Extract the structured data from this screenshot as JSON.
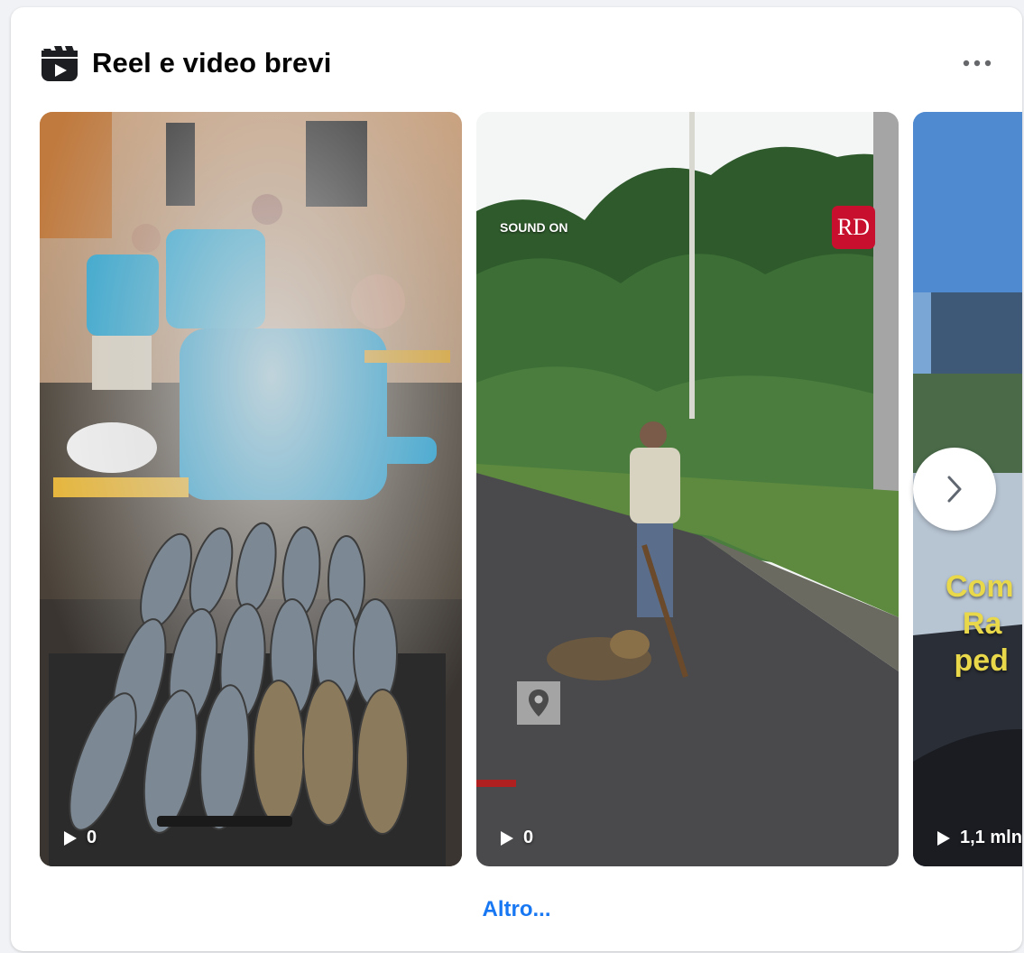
{
  "section": {
    "title": "Reel e video brevi",
    "icon": "reels-icon",
    "more_icon": "more-options-icon"
  },
  "reels": [
    {
      "views": "0",
      "play_icon": "play-icon",
      "scene": "grilled fish on barbecue with people in blue shirts"
    },
    {
      "views": "0",
      "play_icon": "play-icon",
      "sound_label": "SOUND ON",
      "badge": "RD",
      "location_icon": "location-pin-icon",
      "scene": "man with stick next to sloth on road"
    },
    {
      "views": "1,1 mln",
      "play_icon": "play-icon",
      "overlay_text": "Com\n  Ra\n ped"
    }
  ],
  "navigation": {
    "next_icon": "chevron-right-icon"
  },
  "footer": {
    "see_more": "Altro..."
  },
  "colors": {
    "link": "#1877f2",
    "title": "#050505",
    "badge": "#c8102e"
  }
}
